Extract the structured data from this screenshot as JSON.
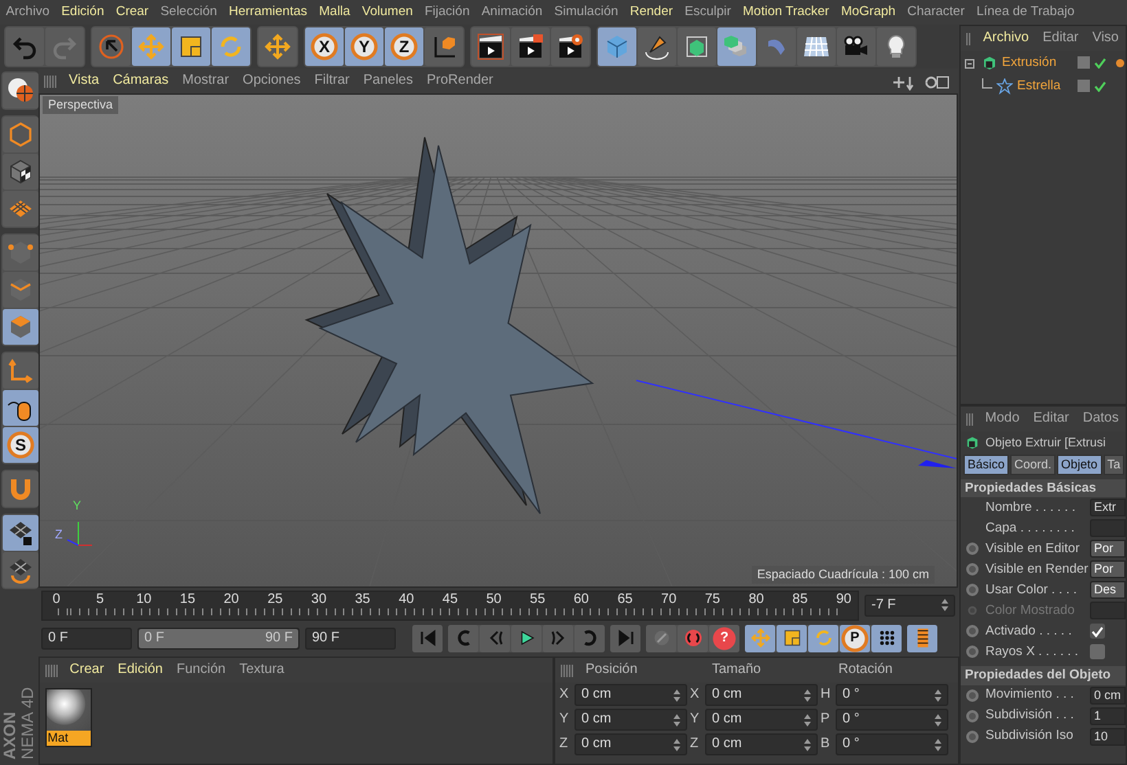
{
  "menu": [
    {
      "label": "Archivo",
      "highlighted": false
    },
    {
      "label": "Edición",
      "highlighted": true
    },
    {
      "label": "Crear",
      "highlighted": true
    },
    {
      "label": "Selección",
      "highlighted": false
    },
    {
      "label": "Herramientas",
      "highlighted": true
    },
    {
      "label": "Malla",
      "highlighted": true
    },
    {
      "label": "Volumen",
      "highlighted": true
    },
    {
      "label": "Fijación",
      "highlighted": false
    },
    {
      "label": "Animación",
      "highlighted": false
    },
    {
      "label": "Simulación",
      "highlighted": false
    },
    {
      "label": "Render",
      "highlighted": true
    },
    {
      "label": "Esculpir",
      "highlighted": false
    },
    {
      "label": "Motion Tracker",
      "highlighted": true
    },
    {
      "label": "MoGraph",
      "highlighted": true
    },
    {
      "label": "Character",
      "highlighted": false
    },
    {
      "label": "Línea de Trabajo",
      "highlighted": false
    }
  ],
  "toolbar": [
    [
      {
        "kind": "undo",
        "selected": false
      },
      {
        "kind": "redo",
        "selected": false
      }
    ],
    [
      {
        "kind": "select",
        "selected": false
      },
      {
        "kind": "move",
        "selected": true
      },
      {
        "kind": "scale",
        "selected": true
      },
      {
        "kind": "rotate",
        "selected": true
      }
    ],
    [
      {
        "kind": "move",
        "selected": false
      }
    ],
    [
      {
        "kind": "letter",
        "label": "X",
        "selected": true
      },
      {
        "kind": "letter",
        "label": "Y",
        "selected": true
      },
      {
        "kind": "letter",
        "label": "Z",
        "selected": true
      },
      {
        "kind": "coord",
        "selected": false
      }
    ],
    [
      {
        "kind": "render-view",
        "selected": false
      },
      {
        "kind": "render-picture",
        "selected": false
      },
      {
        "kind": "render-settings",
        "selected": false
      }
    ],
    [
      {
        "kind": "cube",
        "selected": true
      },
      {
        "kind": "pen",
        "selected": false
      },
      {
        "kind": "subdivision",
        "selected": false
      },
      {
        "kind": "array",
        "selected": true
      },
      {
        "kind": "deformer",
        "selected": false
      },
      {
        "kind": "floor",
        "selected": false
      },
      {
        "kind": "camera",
        "selected": false
      },
      {
        "kind": "light",
        "selected": false
      }
    ]
  ],
  "left_toolbar": [
    [
      {
        "kind": "globe",
        "selected": false
      }
    ],
    [
      {
        "kind": "model",
        "selected": false
      },
      {
        "kind": "texture",
        "selected": false
      },
      {
        "kind": "workplane",
        "selected": false
      }
    ],
    [
      {
        "kind": "points",
        "selected": false
      },
      {
        "kind": "edges",
        "selected": false
      },
      {
        "kind": "polygons",
        "selected": true
      }
    ],
    [
      {
        "kind": "axis",
        "selected": false
      },
      {
        "kind": "mouse",
        "selected": true
      },
      {
        "kind": "letter",
        "label": "S",
        "selected": true
      }
    ],
    [
      {
        "kind": "magnet",
        "selected": false
      }
    ],
    [
      {
        "kind": "lock-grid",
        "selected": true
      },
      {
        "kind": "grid-rotate",
        "selected": false
      }
    ]
  ],
  "viewport": {
    "menu": [
      {
        "label": "Vista",
        "highlighted": true
      },
      {
        "label": "Cámaras",
        "highlighted": true
      },
      {
        "label": "Mostrar",
        "highlighted": false
      },
      {
        "label": "Opciones",
        "highlighted": false
      },
      {
        "label": "Filtrar",
        "highlighted": false
      },
      {
        "label": "Paneles",
        "highlighted": false
      },
      {
        "label": "ProRender",
        "highlighted": false
      }
    ],
    "camera": "Perspectiva",
    "grid_spacing": "Espaciado Cuadrícula : 100 cm",
    "axis_labels": [
      "Y",
      "Z"
    ]
  },
  "timeline": {
    "ticks": [
      "0",
      "5",
      "10",
      "15",
      "20",
      "25",
      "30",
      "35",
      "40",
      "45",
      "50",
      "55",
      "60",
      "65",
      "70",
      "75",
      "80",
      "85",
      "90"
    ],
    "current_frame": "-7 F"
  },
  "transport": {
    "start": "0 F",
    "range": {
      "start": "0 F",
      "end": "90 F",
      "level": 1
    },
    "end": "90 F",
    "groups": [
      [
        {
          "kind": "first",
          "selected": false
        }
      ],
      [
        {
          "kind": "prev-key",
          "selected": false
        },
        {
          "kind": "prev-frame",
          "selected": false
        },
        {
          "kind": "play",
          "selected": false
        },
        {
          "kind": "next-frame",
          "selected": false
        },
        {
          "kind": "next-key",
          "selected": false
        }
      ],
      [
        {
          "kind": "last",
          "selected": false
        }
      ],
      [
        {
          "kind": "record",
          "selected": false
        },
        {
          "kind": "autokey",
          "selected": false
        },
        {
          "kind": "help",
          "label": "?",
          "selected": false
        }
      ],
      [
        {
          "kind": "move",
          "selected": true
        },
        {
          "kind": "scale",
          "selected": true
        },
        {
          "kind": "rotate",
          "selected": true
        },
        {
          "kind": "letter",
          "label": "P",
          "selected": true
        },
        {
          "kind": "dots",
          "selected": true
        }
      ],
      [
        {
          "kind": "film",
          "selected": true
        }
      ]
    ]
  },
  "logo": [
    "AXON",
    "NEMA 4D"
  ],
  "material_manager": {
    "menu": [
      {
        "label": "Crear",
        "highlighted": true
      },
      {
        "label": "Edición",
        "highlighted": true
      },
      {
        "label": "Función",
        "highlighted": false
      },
      {
        "label": "Textura",
        "highlighted": false
      }
    ],
    "materials": [
      {
        "name": "Mat",
        "selected": true
      }
    ]
  },
  "coordinates": {
    "headers": [
      "Posición",
      "Tamaño",
      "Rotación"
    ],
    "rows": [
      {
        "axis": "X",
        "position": "0 cm",
        "size_axis": "X",
        "size": "0 cm",
        "rotation_axis": "H",
        "rotation": "0 °"
      },
      {
        "axis": "Y",
        "position": "0 cm",
        "size_axis": "Y",
        "size": "0 cm",
        "rotation_axis": "P",
        "rotation": "0 °"
      },
      {
        "axis": "Z",
        "position": "0 cm",
        "size_axis": "Z",
        "size": "0 cm",
        "rotation_axis": "B",
        "rotation": "0 °"
      }
    ]
  },
  "object_manager": {
    "menu": [
      {
        "label": "Archivo",
        "highlighted": true
      },
      {
        "label": "Editar",
        "highlighted": false
      },
      {
        "label": "Viso",
        "highlighted": false
      }
    ],
    "objects": [
      {
        "name": "Extrusión",
        "kind": "extrude",
        "enabled": true,
        "tag": true,
        "children": [
          {
            "name": "Estrella",
            "kind": "star",
            "enabled": true,
            "tag": false
          }
        ]
      }
    ]
  },
  "attributes": {
    "menu": [
      "Modo",
      "Editar",
      "Datos"
    ],
    "title": "Objeto Extruir [Extrusi",
    "tabs": [
      {
        "label": "Básico",
        "selected": true
      },
      {
        "label": "Coord.",
        "selected": false
      },
      {
        "label": "Objeto",
        "selected": true
      },
      {
        "label": "Ta",
        "selected": false
      }
    ],
    "sections": [
      {
        "title": "Propiedades Básicas",
        "rows": [
          {
            "label": "Nombre . . . . . .",
            "kind": "text",
            "value": "Extr",
            "keyframe": false,
            "disabled": false
          },
          {
            "label": "Capa . . . . . . . .",
            "kind": "empty",
            "keyframe": false,
            "disabled": false
          },
          {
            "label": "Visible en Editor",
            "kind": "dropdown",
            "value": "Por",
            "keyframe": true,
            "disabled": false
          },
          {
            "label": "Visible en Render",
            "kind": "dropdown",
            "value": "Por",
            "keyframe": true,
            "disabled": false
          },
          {
            "label": "Usar Color . . . .",
            "kind": "dropdown",
            "value": "Des",
            "keyframe": true,
            "disabled": false
          },
          {
            "label": "Color Mostrado",
            "kind": "empty",
            "keyframe": true,
            "disabled": true
          },
          {
            "label": "Activado . . . . .",
            "kind": "check",
            "checked": true,
            "keyframe": true,
            "disabled": false
          },
          {
            "label": "Rayos X . . . . . .",
            "kind": "check",
            "checked": false,
            "keyframe": true,
            "disabled": false
          }
        ]
      },
      {
        "title": "Propiedades del Objeto",
        "rows": [
          {
            "label": "Movimiento . . .",
            "kind": "text",
            "value": "0 cm",
            "keyframe": true,
            "disabled": false
          },
          {
            "label": "Subdivisión . . .",
            "kind": "text",
            "value": "1",
            "keyframe": true,
            "disabled": false
          },
          {
            "label": "Subdivisión Iso",
            "kind": "text",
            "value": "10",
            "keyframe": true,
            "disabled": false
          }
        ]
      }
    ]
  }
}
